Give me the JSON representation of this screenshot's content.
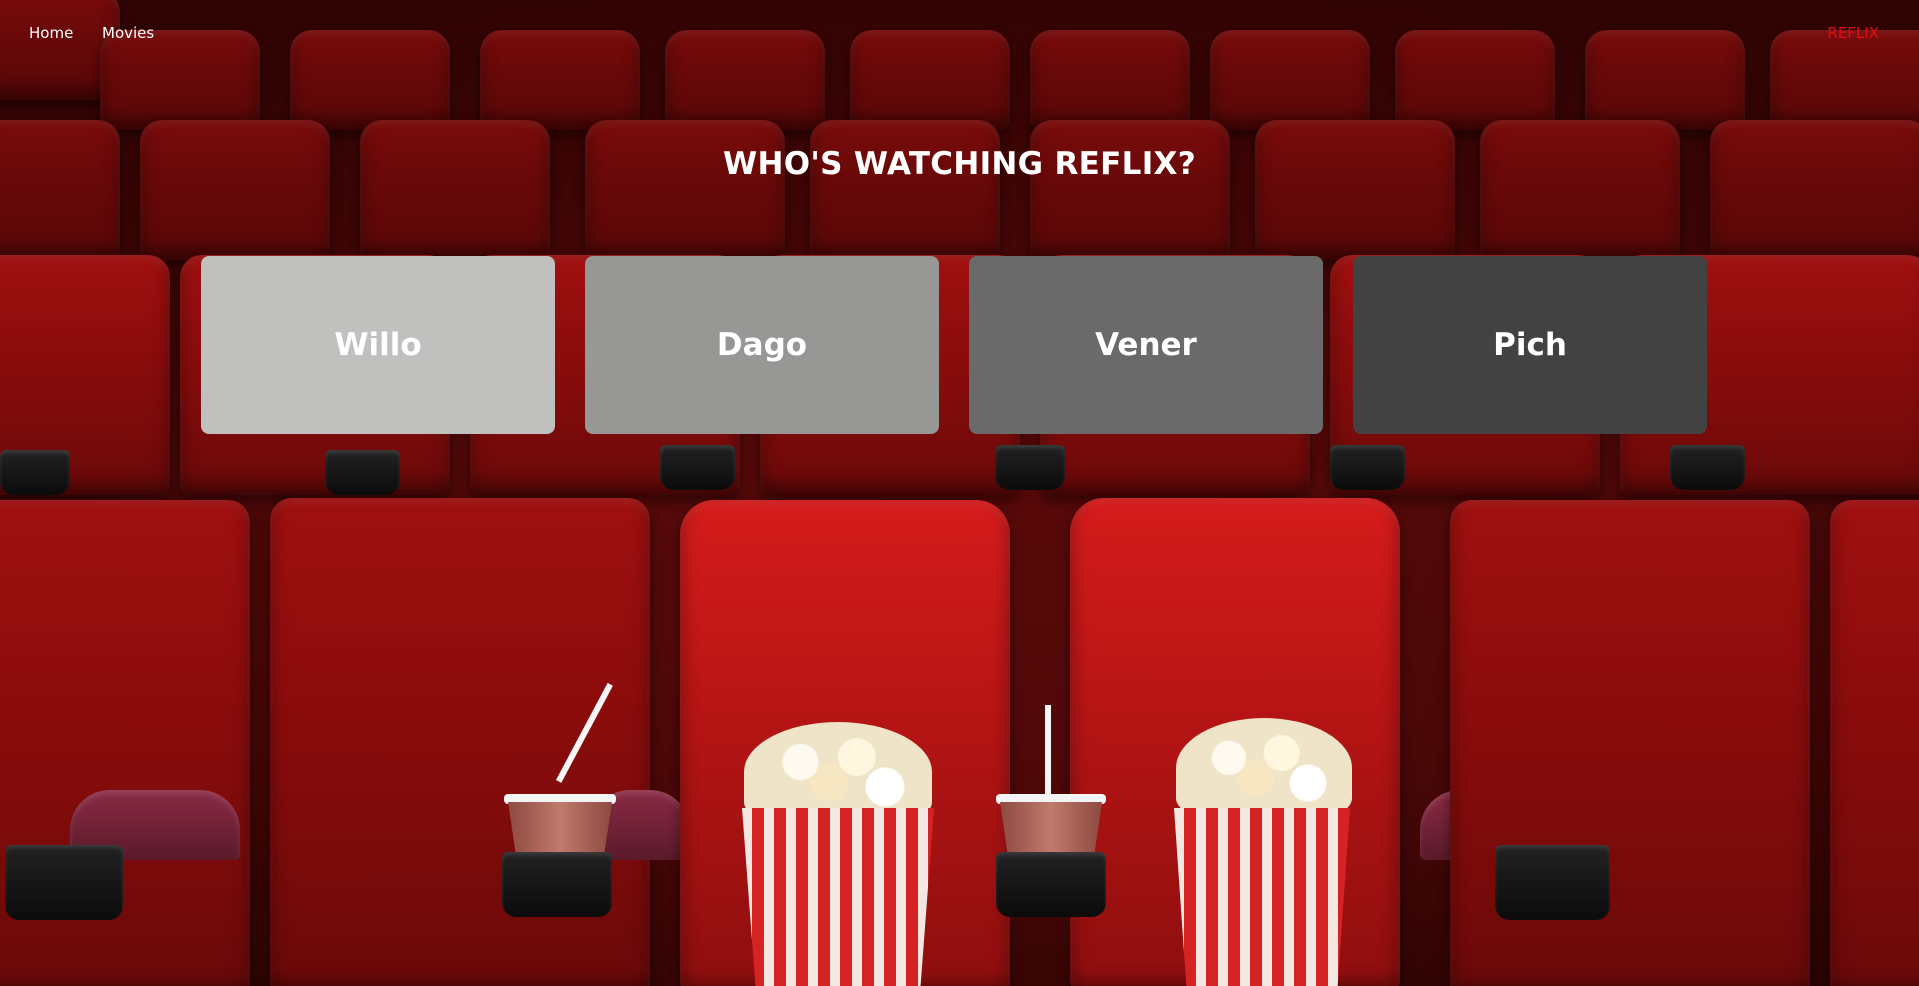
{
  "nav": {
    "home_label": "Home",
    "movies_label": "Movies",
    "brand_label": "REFLIX"
  },
  "heading": "WHO'S WATCHING REFLIX?",
  "profiles": [
    {
      "name": "Willo",
      "color": "#c0c0be"
    },
    {
      "name": "Dago",
      "color": "#979796"
    },
    {
      "name": "Vener",
      "color": "#6a6a6a"
    },
    {
      "name": "Pich",
      "color": "#424242"
    }
  ],
  "colors": {
    "brand": "#e50914",
    "text": "#ffffff"
  },
  "background": {
    "description_icon": "cinema-seats-background"
  }
}
